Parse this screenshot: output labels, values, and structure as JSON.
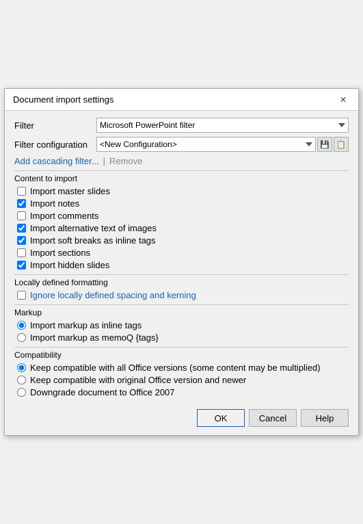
{
  "dialog": {
    "title": "Document import settings",
    "close_label": "✕"
  },
  "filter": {
    "label": "Filter",
    "selected": "Microsoft PowerPoint filter"
  },
  "filter_configuration": {
    "label": "Filter configuration",
    "selected": "<New Configuration>",
    "options": [
      "<New Configuration>"
    ]
  },
  "links": {
    "add_cascading": "Add cascading filter...",
    "separator": "|",
    "remove": "Remove"
  },
  "content_section": {
    "label": "Content to import",
    "items": [
      {
        "label": "Import master slides",
        "checked": false
      },
      {
        "label": "Import notes",
        "checked": true
      },
      {
        "label": "Import comments",
        "checked": false
      },
      {
        "label": "Import alternative text of images",
        "checked": true
      },
      {
        "label": "Import soft breaks as inline tags",
        "checked": true
      },
      {
        "label": "Import sections",
        "checked": false
      },
      {
        "label": "Import hidden slides",
        "checked": true
      }
    ]
  },
  "locally_section": {
    "label": "Locally defined formatting",
    "items": [
      {
        "label": "Ignore locally defined spacing and kerning",
        "checked": false
      }
    ]
  },
  "markup_section": {
    "label": "Markup",
    "items": [
      {
        "label": "Import markup as inline tags",
        "checked": true,
        "name": "markup"
      },
      {
        "label": "Import markup as memoQ {tags}",
        "checked": false,
        "name": "markup"
      }
    ]
  },
  "compatibility_section": {
    "label": "Compatibility",
    "items": [
      {
        "label": "Keep compatible with all Office versions (some content may be multiplied)",
        "checked": true,
        "name": "compat"
      },
      {
        "label": "Keep compatible with original Office version and newer",
        "checked": false,
        "name": "compat"
      },
      {
        "label": "Downgrade document to Office 2007",
        "checked": false,
        "name": "compat"
      }
    ]
  },
  "footer": {
    "ok_label": "OK",
    "cancel_label": "Cancel",
    "help_label": "Help"
  }
}
